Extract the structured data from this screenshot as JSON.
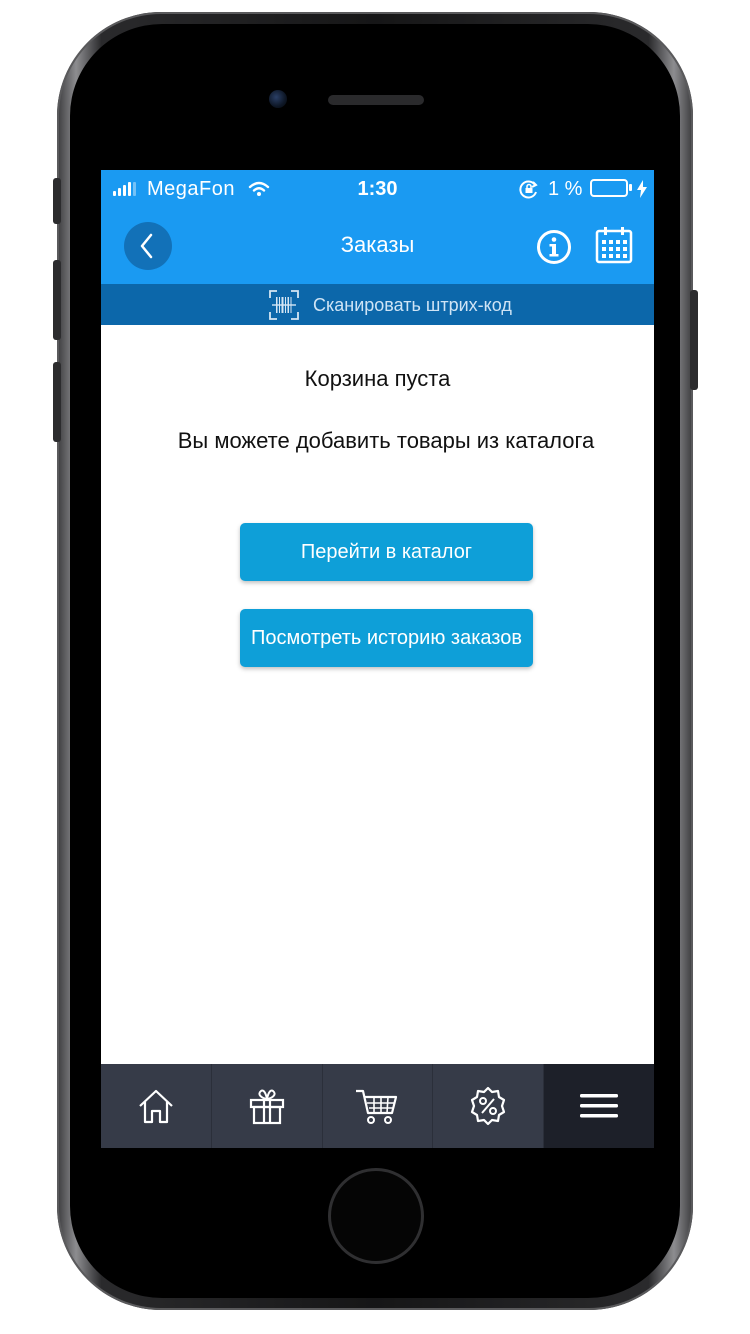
{
  "status_bar": {
    "carrier": "MegaFon",
    "time": "1:30",
    "battery_percent": "1 %"
  },
  "nav": {
    "title": "Заказы"
  },
  "scan": {
    "label": "Сканировать штрих-код"
  },
  "content": {
    "empty_title": "Корзина пуста",
    "empty_hint": "Вы можете добавить товары из каталога",
    "catalog_button": "Перейти в каталог",
    "history_button": "Посмотреть историю заказов"
  },
  "tabs": [
    {
      "icon": "home-icon",
      "active": false
    },
    {
      "icon": "gift-icon",
      "active": false
    },
    {
      "icon": "cart-icon",
      "active": false
    },
    {
      "icon": "discount-icon",
      "active": false
    },
    {
      "icon": "menu-icon",
      "active": true
    }
  ],
  "colors": {
    "header_blue": "#1a9af2",
    "scan_bar": "#0c67aa",
    "button_blue": "#0e9fd8",
    "tab_bar": "#363b48"
  }
}
